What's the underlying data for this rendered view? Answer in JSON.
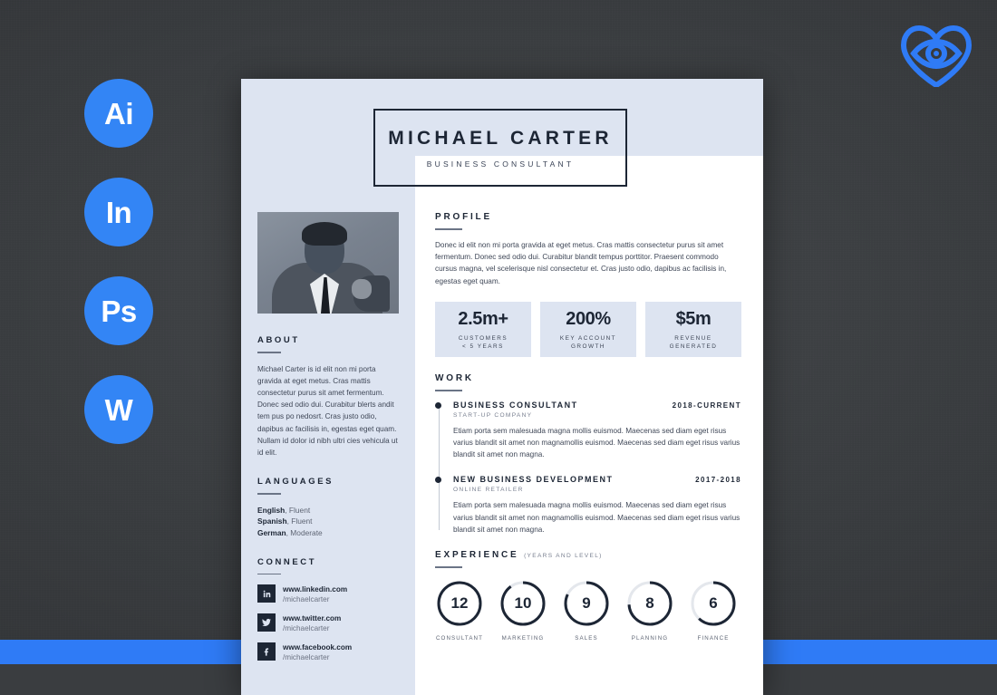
{
  "background": {
    "accent_blue": "#2f7bf6",
    "badge_blue": "#3385f5",
    "dark": "#3a3d40"
  },
  "app_badges": [
    {
      "label": "Ai",
      "name": "illustrator"
    },
    {
      "label": "In",
      "name": "indesign"
    },
    {
      "label": "Ps",
      "name": "photoshop"
    },
    {
      "label": "W",
      "name": "word"
    }
  ],
  "logo": {
    "name": "heart-eye-logo",
    "color": "#2f7bf6"
  },
  "resume": {
    "header": {
      "name": "MICHAEL CARTER",
      "title": "BUSINESS CONSULTANT"
    },
    "sidebar": {
      "about": {
        "heading": "ABOUT",
        "body": "Michael Carter is id elit non mi porta gravida at eget metus. Cras mattis consectetur purus sit amet fermentum. Donec sed odio dui. Curabitur blerts andit tem pus po nedosrt. Cras justo odio, dapibus ac facilisis in, egestas eget quam. Nullam id dolor id nibh ultri cies vehicula ut id elit."
      },
      "languages": {
        "heading": "LANGUAGES",
        "items": [
          {
            "lang": "English",
            "level": ", Fluent"
          },
          {
            "lang": "Spanish",
            "level": ", Fluent"
          },
          {
            "lang": "German",
            "level": ", Moderate"
          }
        ]
      },
      "connect": {
        "heading": "CONNECT",
        "items": [
          {
            "icon": "linkedin-icon",
            "glyph": "in",
            "site": "www.linkedin.com",
            "handle": "/michaelcarter"
          },
          {
            "icon": "twitter-icon",
            "glyph": "ᴠ",
            "site": "www.twitter.com",
            "handle": "/michaelcarter"
          },
          {
            "icon": "facebook-icon",
            "glyph": "f",
            "site": "www.facebook.com",
            "handle": "/michaelcarter"
          }
        ]
      }
    },
    "main": {
      "profile": {
        "heading": "PROFILE",
        "body": "Donec id elit non mi porta gravida at eget metus. Cras mattis consectetur purus sit amet fermentum. Donec sed odio dui. Curabitur blandit tempus porttitor. Praesent commodo cursus magna, vel scelerisque nisl consectetur et. Cras justo odio, dapibus ac facilisis in, egestas eget quam."
      },
      "stats": [
        {
          "value": "2.5m+",
          "label": "CUSTOMERS\n< 5 YEARS"
        },
        {
          "value": "200%",
          "label": "KEY ACCOUNT\nGROWTH"
        },
        {
          "value": "$5m",
          "label": "REVENUE\nGENERATED"
        }
      ],
      "work": {
        "heading": "WORK",
        "jobs": [
          {
            "role": "BUSINESS CONSULTANT",
            "date": "2018-CURRENT",
            "company": "START-UP COMPANY",
            "body": "Etiam porta sem malesuada magna mollis euismod. Maecenas sed diam eget risus varius blandit sit amet non magnamollis euismod. Maecenas sed diam eget risus varius blandit sit amet non magna."
          },
          {
            "role": "NEW BUSINESS DEVELOPMENT",
            "date": "2017-2018",
            "company": "ONLINE RETAILER",
            "body": "Etiam porta sem malesuada magna mollis euismod. Maecenas sed diam eget risus varius blandit sit amet non magnamollis euismod. Maecenas sed diam eget risus varius blandit sit amet non magna."
          }
        ]
      },
      "experience": {
        "heading": "EXPERIENCE",
        "subheading": "(YEARS AND LEVEL)",
        "items": [
          {
            "value": "12",
            "label": "CONSULTANT",
            "percent": 100
          },
          {
            "value": "10",
            "label": "MARKETING",
            "percent": 90
          },
          {
            "value": "9",
            "label": "SALES",
            "percent": 82
          },
          {
            "value": "8",
            "label": "PLANNING",
            "percent": 74
          },
          {
            "value": "6",
            "label": "FINANCE",
            "percent": 62
          }
        ]
      }
    }
  }
}
